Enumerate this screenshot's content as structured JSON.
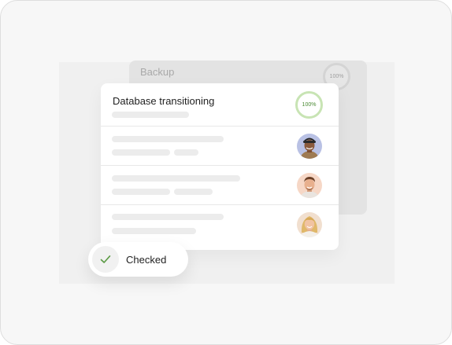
{
  "background_card": {
    "title": "Backup",
    "progress_label": "100%"
  },
  "main_card": {
    "title": "Database transitioning",
    "progress_label": "100%",
    "progress": 1.0,
    "rows": [
      {
        "avatar_icon": "person-avatar-1"
      },
      {
        "avatar_icon": "person-avatar-2"
      },
      {
        "avatar_icon": "person-avatar-3"
      }
    ]
  },
  "toast": {
    "label": "Checked",
    "icon": "checkmark-icon"
  },
  "colors": {
    "accent_green": "#4b8a34",
    "ring_green": "#c8e4b4",
    "skeleton": "#ececec"
  }
}
